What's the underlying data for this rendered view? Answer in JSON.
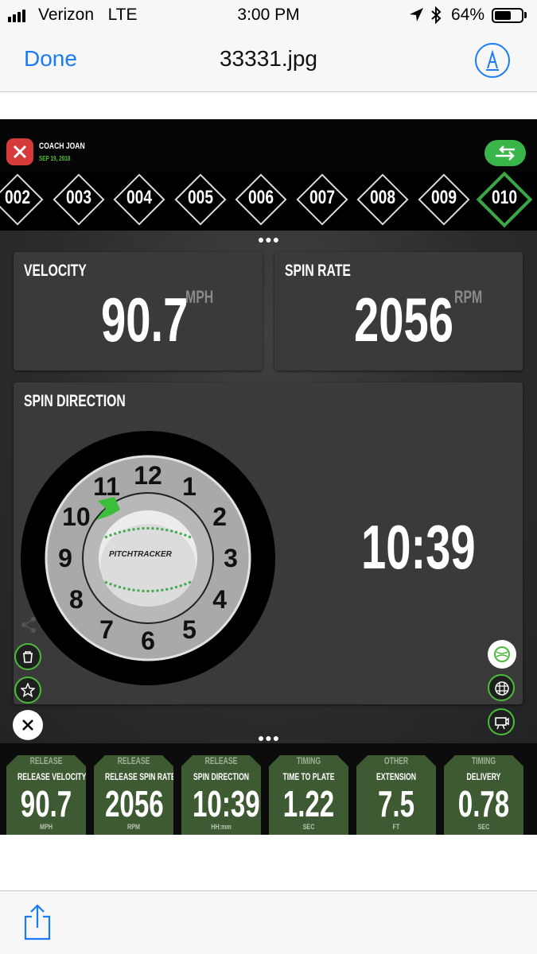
{
  "status_bar": {
    "carrier": "Verizon",
    "network": "LTE",
    "time": "3:00 PM",
    "battery_percent": "64%",
    "battery_level": 0.64,
    "icons": [
      "signal-bars-icon",
      "location-arrow-icon",
      "bluetooth-icon",
      "battery-icon"
    ]
  },
  "nav": {
    "done_label": "Done",
    "title": "33331.jpg",
    "markup_icon": "markup-pen-icon",
    "accent_color": "#1a7cf5"
  },
  "app": {
    "coach": "COACH JOAN",
    "date": "SEP 19, 2018",
    "brand_green": "#3ab54a",
    "pitches": [
      {
        "label": "002",
        "active": false
      },
      {
        "label": "003",
        "active": false
      },
      {
        "label": "004",
        "active": false
      },
      {
        "label": "005",
        "active": false
      },
      {
        "label": "006",
        "active": false
      },
      {
        "label": "007",
        "active": false
      },
      {
        "label": "008",
        "active": false
      },
      {
        "label": "009",
        "active": false
      },
      {
        "label": "010",
        "active": true
      }
    ],
    "velocity": {
      "label": "VELOCITY",
      "value": "90.7",
      "unit": "MPH"
    },
    "spin_rate": {
      "label": "SPIN RATE",
      "value": "2056",
      "unit": "RPM"
    },
    "spin_direction": {
      "label": "SPIN DIRECTION",
      "value": "10:39",
      "clock_numbers": [
        "12",
        "1",
        "2",
        "3",
        "4",
        "5",
        "6",
        "7",
        "8",
        "9",
        "10",
        "11"
      ],
      "ball_brand": "PITCHTRACKER"
    },
    "side_buttons_left": [
      "share-icon",
      "trash-icon",
      "star-icon",
      "close-icon"
    ],
    "side_buttons_right": [
      "baseball-icon",
      "grid-icon",
      "video-camera-icon"
    ],
    "metrics": [
      {
        "category": "RELEASE",
        "name": "RELEASE VELOCITY",
        "value": "90.7",
        "unit": "MPH"
      },
      {
        "category": "RELEASE",
        "name": "RELEASE SPIN RATE",
        "value": "2056",
        "unit": "RPM"
      },
      {
        "category": "RELEASE",
        "name": "SPIN DIRECTION",
        "value": "10:39",
        "unit": "HH:mm"
      },
      {
        "category": "TIMING",
        "name": "TIME TO PLATE",
        "value": "1.22",
        "unit": "SEC"
      },
      {
        "category": "OTHER",
        "name": "EXTENSION",
        "value": "7.5",
        "unit": "FT"
      },
      {
        "category": "TIMING",
        "name": "DELIVERY",
        "value": "0.78",
        "unit": "SEC"
      }
    ]
  },
  "toolbar": {
    "share_icon": "share-icon"
  }
}
